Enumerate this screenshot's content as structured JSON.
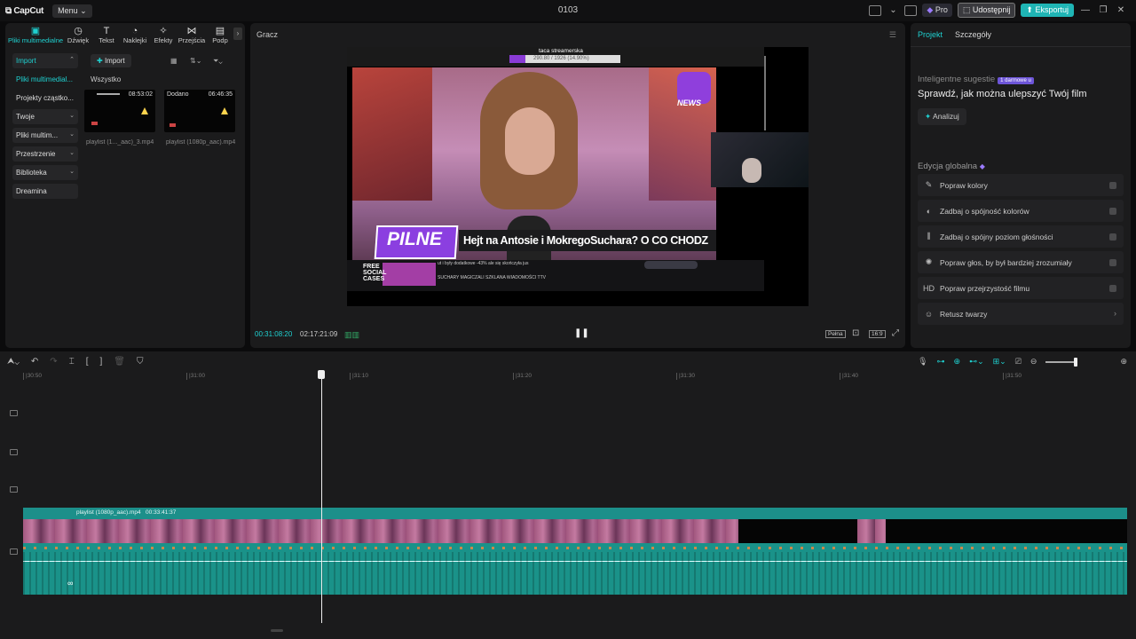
{
  "app": {
    "logo": "CapCut",
    "menu_label": "Menu",
    "project_title": "0103",
    "pro_label": "Pro",
    "share_label": "Udostępnij",
    "export_label": "Eksportuj"
  },
  "toolbar": {
    "tabs": [
      {
        "label": "Pliki multimedialne",
        "icon": "media-icon",
        "active": true
      },
      {
        "label": "Dźwięk",
        "icon": "audio-icon"
      },
      {
        "label": "Tekst",
        "icon": "text-icon"
      },
      {
        "label": "Naklejki",
        "icon": "sticker-icon"
      },
      {
        "label": "Efekty",
        "icon": "effects-icon"
      },
      {
        "label": "Przejścia",
        "icon": "transition-icon"
      },
      {
        "label": "Podp",
        "icon": "caption-icon"
      }
    ]
  },
  "media": {
    "sidebar": [
      "Import",
      "Pliki multimedial...",
      "Projekty cząstko...",
      "Twoje",
      "Pliki multim...",
      "Przestrzenie",
      "Biblioteka",
      "Dreamina"
    ],
    "import_button": "Import",
    "filter_label": "Wszystko",
    "files": [
      {
        "name": "playlist (1..._aac)_3.mp4",
        "duration": "08:53:02",
        "label": ""
      },
      {
        "name": "playlist (1080p_aac).mp4",
        "duration": "06:46:35",
        "label": "Dodano"
      }
    ]
  },
  "player": {
    "title": "Gracz",
    "current_time": "00:31:08:20",
    "total_time": "02:17:21:09",
    "full_label": "Pełna",
    "ratio_label": "16:9",
    "video": {
      "stream_title": "taca streamerska",
      "stream_sub": "290.80 / 1926 (14.90%)",
      "badge_pilne": "PILNE",
      "headline": "Hejt na Antosie i MokregoSuchara? O CO CHODZ",
      "news_label": "NEWS",
      "ad_text": "FREE SOCIAL CASES",
      "ticker": "SUCHARY MAGICZALI SZKLANA WIADOMOŚCI TTV",
      "promo": "ut i były dodatkowe -43% ale się skończyła jus"
    }
  },
  "properties": {
    "tabs": [
      "Projekt",
      "Szczegóły"
    ],
    "suggest_title": "Inteligentne sugestie",
    "suggest_badge": "1 darmowe u",
    "suggest_heading": "Sprawdź, jak można ulepszyć Twój film",
    "analyze_label": "Analizuj",
    "global_title": "Edycja globalna",
    "options": [
      {
        "label": "Popraw kolory",
        "icon": "color-wand-icon"
      },
      {
        "label": "Zadbaj o spójność kolorów",
        "icon": "color-match-icon"
      },
      {
        "label": "Zadbaj o spójny poziom głośności",
        "icon": "volume-level-icon"
      },
      {
        "label": "Popraw głos, by był bardziej zrozumiały",
        "icon": "voice-enhance-icon"
      },
      {
        "label": "Popraw przejrzystość filmu",
        "icon": "hd-icon"
      },
      {
        "label": "Retusz twarzy",
        "icon": "face-retouch-icon"
      }
    ]
  },
  "timeline": {
    "ruler": [
      "|30:50",
      "|31:00",
      "|31:10",
      "|31:20",
      "|31:30",
      "|31:40",
      "|31:50"
    ],
    "clip_name": "playlist (1080p_aac).mp4",
    "clip_duration": "00:33:41:37"
  }
}
